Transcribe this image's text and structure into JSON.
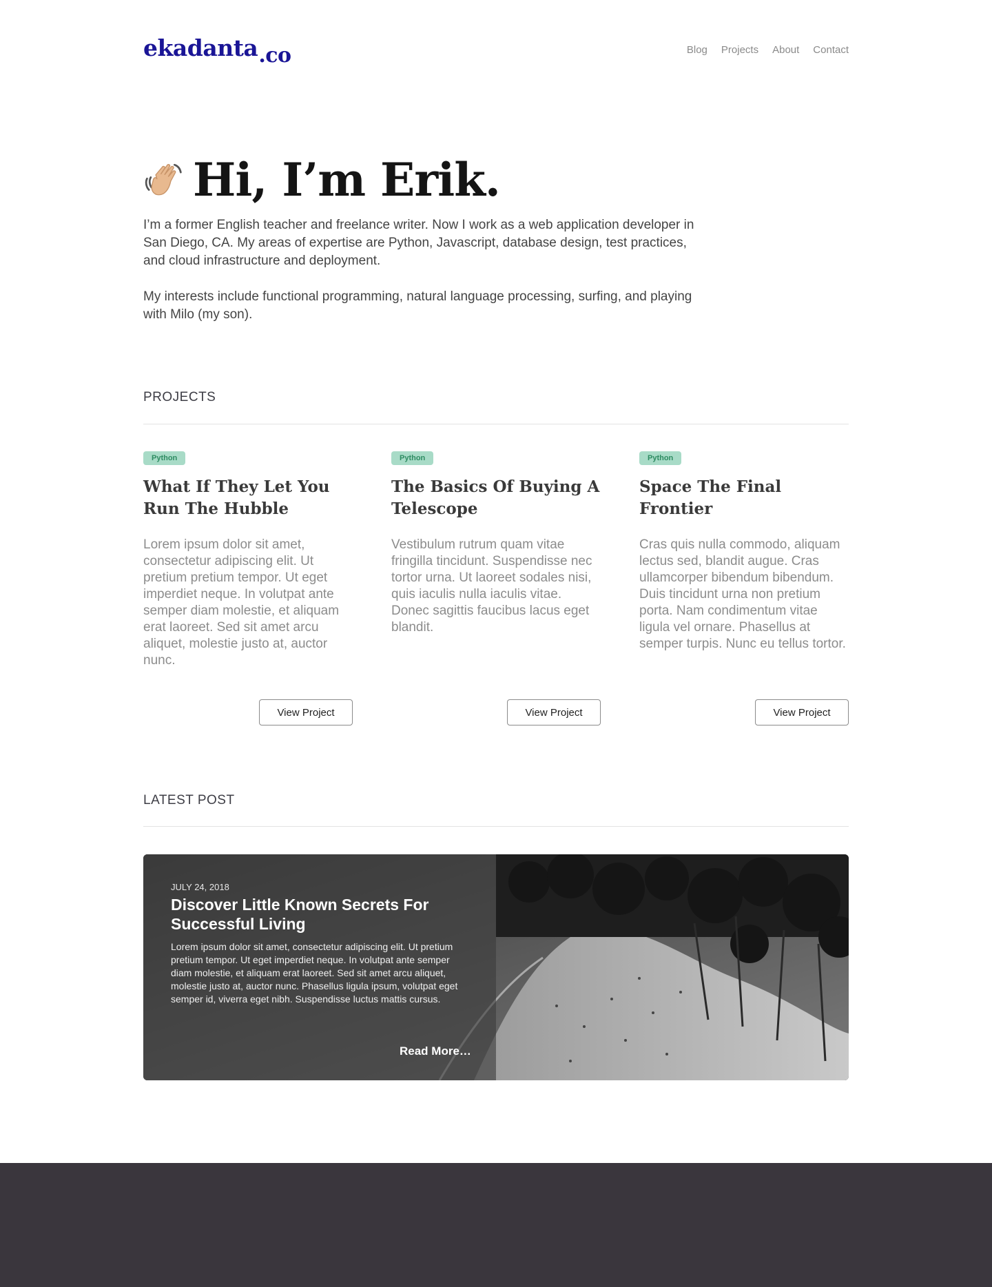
{
  "header": {
    "logo_main": "ekadanta",
    "logo_suffix": ".co",
    "nav": [
      "Blog",
      "Projects",
      "About",
      "Contact"
    ]
  },
  "hero": {
    "emoji_icon": "waving-hand-icon",
    "title": "Hi, I’m Erik.",
    "paragraphs": [
      "I’m a former English teacher and freelance writer. Now I work as a web application developer in San Diego, CA. My areas of expertise are Python, Javascript, database design, test practices, and cloud infrastructure and deployment.",
      "My interests include functional programming, natural language processing, surfing, and playing with Milo (my son)."
    ]
  },
  "projects": {
    "heading": "PROJECTS",
    "button_label": "View Project",
    "items": [
      {
        "tag": "Python",
        "title": "What If They Let You Run The Hubble",
        "description": "Lorem ipsum dolor sit amet, consectetur adipiscing elit. Ut pretium pretium tempor. Ut eget imperdiet neque. In volutpat ante semper diam molestie, et aliquam erat laoreet. Sed sit amet arcu aliquet, molestie justo at, auctor nunc."
      },
      {
        "tag": "Python",
        "title": "The Basics Of Buying A Telescope",
        "description": "Vestibulum rutrum quam vitae fringilla tincidunt. Suspendisse nec tortor urna. Ut laoreet sodales nisi, quis iaculis nulla iaculis vitae. Donec sagittis faucibus lacus eget blandit."
      },
      {
        "tag": "Python",
        "title": "Space The Final Frontier",
        "description": "Cras quis nulla commodo, aliquam lectus sed, blandit augue. Cras ullamcorper bibendum bibendum. Duis tincidunt urna non pretium porta. Nam condimentum vitae ligula vel ornare. Phasellus at semper turpis. Nunc eu tellus tortor."
      }
    ]
  },
  "latest_post": {
    "heading": "LATEST POST",
    "date": "JULY 24, 2018",
    "title": "Discover Little Known Secrets For Successful Living",
    "excerpt": "Lorem ipsum dolor sit amet, consectetur adipiscing elit. Ut pretium pretium tempor. Ut eget imperdiet neque. In volutpat ante semper diam molestie, et aliquam erat laoreet. Sed sit amet arcu aliquet, molestie justo at, auctor nunc. Phasellus ligula ipsum, volutpat eget semper id, viverra eget nibh. Suspendisse luctus mattis cursus.",
    "read_more": "Read More…"
  },
  "colors": {
    "brand": "#1a1596",
    "tag_bg": "#a8dbc7",
    "tag_text": "#2e8c62",
    "footer_bg": "#3a363d"
  }
}
